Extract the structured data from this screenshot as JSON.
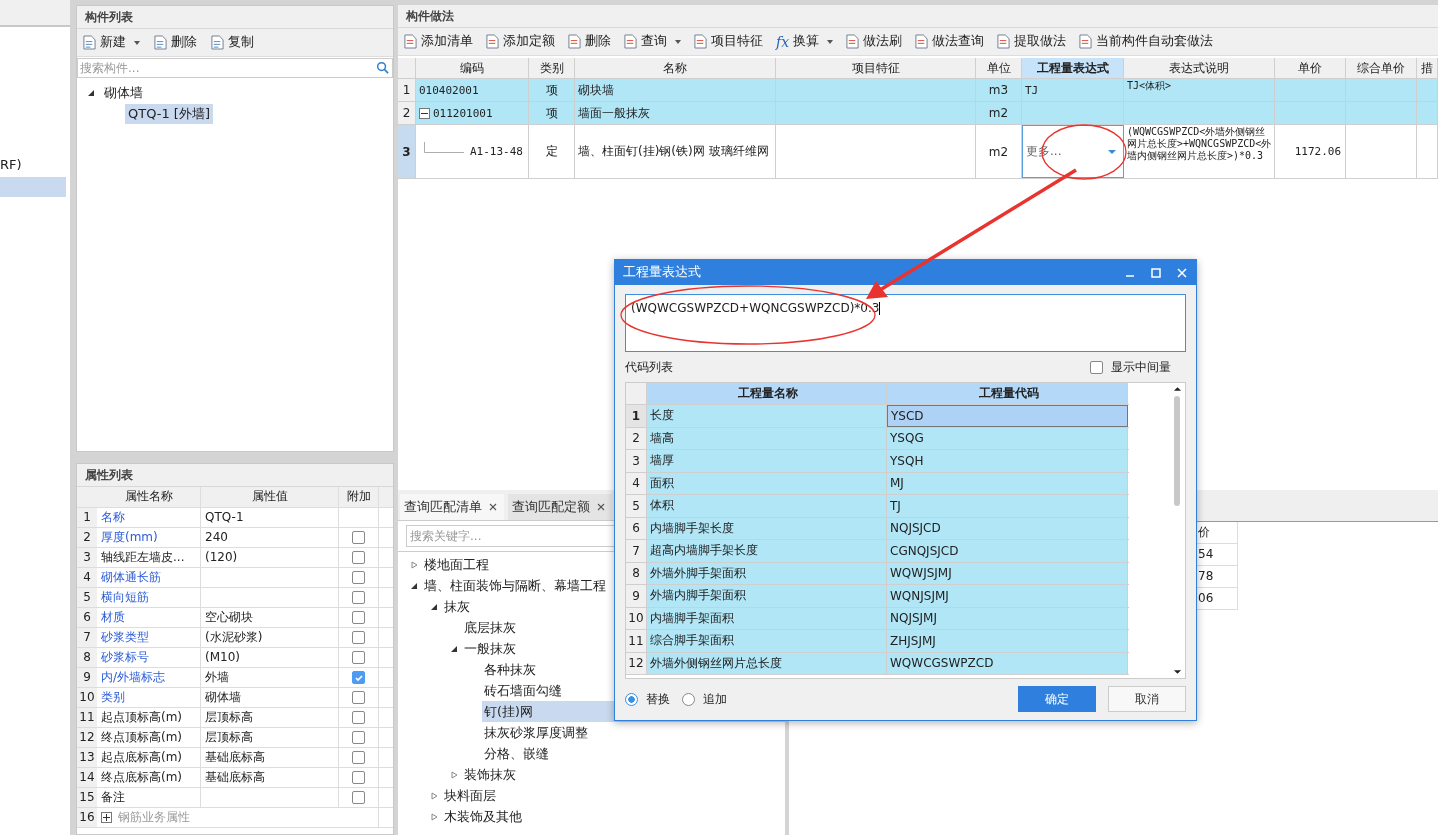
{
  "left_strip": {
    "text": "RF)"
  },
  "component_list": {
    "title": "构件列表",
    "toolbar": [
      {
        "label": "新建",
        "dropdown": true
      },
      {
        "label": "删除",
        "dropdown": false
      },
      {
        "label": "复制",
        "dropdown": false
      }
    ],
    "search": {
      "placeholder": "搜索构件..."
    },
    "tree": [
      {
        "label": "砌体墙",
        "expanded": true,
        "selected": false,
        "children": [
          {
            "label": "QTQ-1 [外墙]",
            "selected": true
          }
        ]
      }
    ]
  },
  "properties": {
    "title": "属性列表",
    "columns": [
      "属性名称",
      "属性值",
      "附加"
    ],
    "rows": [
      {
        "num": "1",
        "name": "名称",
        "public": true,
        "value": "QTQ-1",
        "kind": "text"
      },
      {
        "num": "2",
        "name": "厚度(mm)",
        "public": true,
        "value": "240",
        "kind": "check",
        "checked": false
      },
      {
        "num": "3",
        "name": "轴线距左墙皮...",
        "public": false,
        "value": "(120)",
        "kind": "check",
        "checked": false
      },
      {
        "num": "4",
        "name": "砌体通长筋",
        "public": true,
        "kind": "check",
        "checked": false
      },
      {
        "num": "5",
        "name": "横向短筋",
        "public": true,
        "kind": "check",
        "checked": false
      },
      {
        "num": "6",
        "name": "材质",
        "public": true,
        "value": "空心砌块",
        "kind": "check",
        "checked": false
      },
      {
        "num": "7",
        "name": "砂浆类型",
        "public": true,
        "value": "(水泥砂浆)",
        "kind": "check",
        "checked": false
      },
      {
        "num": "8",
        "name": "砂浆标号",
        "public": true,
        "value": "(M10)",
        "kind": "check",
        "checked": false
      },
      {
        "num": "9",
        "name": "内/外墙标志",
        "public": true,
        "value": "外墙",
        "kind": "check",
        "checked": true
      },
      {
        "num": "10",
        "name": "类别",
        "public": true,
        "value": "砌体墙",
        "kind": "check",
        "checked": false
      },
      {
        "num": "11",
        "name": "起点顶标高(m)",
        "public": false,
        "value": "层顶标高",
        "kind": "check",
        "checked": false
      },
      {
        "num": "12",
        "name": "终点顶标高(m)",
        "public": false,
        "value": "层顶标高",
        "kind": "check",
        "checked": false
      },
      {
        "num": "13",
        "name": "起点底标高(m)",
        "public": false,
        "value": "基础底标高",
        "kind": "check",
        "checked": false
      },
      {
        "num": "14",
        "name": "终点底标高(m)",
        "public": false,
        "value": "基础底标高",
        "kind": "check",
        "checked": false
      },
      {
        "num": "15",
        "name": "备注",
        "public": false,
        "kind": "check",
        "checked": false
      },
      {
        "num": "16",
        "name": "钢筋业务属性",
        "public": false,
        "kind": "group",
        "expanded": false
      }
    ]
  },
  "method": {
    "title": "构件做法",
    "toolbar": [
      {
        "label": "添加清单",
        "dropdown": false
      },
      {
        "label": "添加定额",
        "dropdown": false
      },
      {
        "label": "删除",
        "dropdown": false
      },
      {
        "label": "查询",
        "dropdown": true
      },
      {
        "label": "项目特征",
        "dropdown": false
      },
      {
        "label": "换算",
        "dropdown": true,
        "icon_text": "fx"
      },
      {
        "label": "做法刷",
        "dropdown": false
      },
      {
        "label": "做法查询",
        "dropdown": false
      },
      {
        "label": "提取做法",
        "dropdown": false
      },
      {
        "label": "当前构件自动套做法",
        "dropdown": false
      }
    ],
    "columns": [
      {
        "label": "编码",
        "selected": false
      },
      {
        "label": "类别",
        "selected": false
      },
      {
        "label": "名称",
        "selected": false
      },
      {
        "label": "项目特征",
        "selected": false
      },
      {
        "label": "单位",
        "selected": false
      },
      {
        "label": "工程量表达式",
        "selected": true
      },
      {
        "label": "表达式说明",
        "selected": false
      },
      {
        "label": "单价",
        "selected": false
      },
      {
        "label": "综合单价",
        "selected": false
      },
      {
        "label": "措",
        "selected": false
      }
    ],
    "rows": [
      {
        "num": "1",
        "code": "010402001",
        "type": "项",
        "name": "砌块墙",
        "unit": "m3",
        "expr": "TJ",
        "expr_desc": "TJ<体积>",
        "kind": "list",
        "selected": false
      },
      {
        "num": "2",
        "code": "011201001",
        "type": "项",
        "name": "墙面一般抹灰",
        "unit": "m2",
        "kind": "list",
        "expanded": true,
        "selected": false
      },
      {
        "num": "3",
        "code": "A1-13-48",
        "type": "定",
        "name": "墙、柱面钉(挂)钢(铁)网 玻璃纤维网",
        "unit": "m2",
        "expr": "更多...",
        "expr_desc": "(WQWCGSWPZCD<外墙外侧钢丝网片总长度>+WQNCGSWPZCD<外墙内侧钢丝网片总长度>)*0.3",
        "price": "1172.06",
        "kind": "quota",
        "selected": true,
        "editing": true
      }
    ]
  },
  "bottom_tabs": [
    {
      "label": "查询匹配清单",
      "selected": true
    },
    {
      "label": "查询匹配定额",
      "selected": false
    }
  ],
  "bottom_search": {
    "placeholder": "搜索关键字..."
  },
  "category_tree": [
    {
      "label": "楼地面工程",
      "expanded": false,
      "selected": false
    },
    {
      "label": "墙、柱面装饰与隔断、幕墙工程",
      "expanded": true,
      "selected": false,
      "children": [
        {
          "label": "抹灰",
          "expanded": true,
          "selected": false,
          "children": [
            {
              "label": "底层抹灰",
              "selected": false
            },
            {
              "label": "一般抹灰",
              "expanded": true,
              "selected": false,
              "children": [
                {
                  "label": "各种抹灰",
                  "selected": false
                },
                {
                  "label": "砖石墙面勾缝",
                  "selected": false
                },
                {
                  "label": "钉(挂)网",
                  "selected": true
                },
                {
                  "label": "抹灰砂浆厚度调整",
                  "selected": false
                },
                {
                  "label": "分格、嵌缝",
                  "selected": false
                }
              ]
            },
            {
              "label": "装饰抹灰",
              "expanded": false,
              "selected": false
            }
          ]
        },
        {
          "label": "块料面层",
          "expanded": false,
          "selected": false
        },
        {
          "label": "木装饰及其他",
          "expanded": false,
          "selected": false
        }
      ]
    }
  ],
  "price_table": {
    "column": "价",
    "cells": [
      "54",
      "78",
      "06"
    ]
  },
  "dialog": {
    "title": "工程量表达式",
    "expression": "(WQWCGSWPZCD+WQNCGSWPZCD)*0.3",
    "list_label": "代码列表",
    "show_intermediate": {
      "label": "显示中间量",
      "checked": false
    },
    "columns": [
      "工程量名称",
      "工程量代码"
    ],
    "rows": [
      {
        "num": "1",
        "name": "长度",
        "code": "YSCD",
        "selected": true
      },
      {
        "num": "2",
        "name": "墙高",
        "code": "YSQG",
        "selected": false
      },
      {
        "num": "3",
        "name": "墙厚",
        "code": "YSQH",
        "selected": false
      },
      {
        "num": "4",
        "name": "面积",
        "code": "MJ",
        "selected": false
      },
      {
        "num": "5",
        "name": "体积",
        "code": "TJ",
        "selected": false
      },
      {
        "num": "6",
        "name": "内墙脚手架长度",
        "code": "NQJSJCD",
        "selected": false
      },
      {
        "num": "7",
        "name": "超高内墙脚手架长度",
        "code": "CGNQJSJCD",
        "selected": false
      },
      {
        "num": "8",
        "name": "外墙外脚手架面积",
        "code": "WQWJSJMJ",
        "selected": false
      },
      {
        "num": "9",
        "name": "外墙内脚手架面积",
        "code": "WQNJSJMJ",
        "selected": false
      },
      {
        "num": "10",
        "name": "内墙脚手架面积",
        "code": "NQJSJMJ",
        "selected": false
      },
      {
        "num": "11",
        "name": "综合脚手架面积",
        "code": "ZHJSJMJ",
        "selected": false
      },
      {
        "num": "12",
        "name": "外墙外侧钢丝网片总长度",
        "code": "WQWCGSWPZCD",
        "selected": false
      }
    ],
    "modes": [
      {
        "label": "替换",
        "selected": true
      },
      {
        "label": "追加",
        "selected": false
      }
    ],
    "buttons": [
      {
        "label": "确定",
        "kind": "primary"
      },
      {
        "label": "取消",
        "kind": "normal"
      }
    ]
  }
}
